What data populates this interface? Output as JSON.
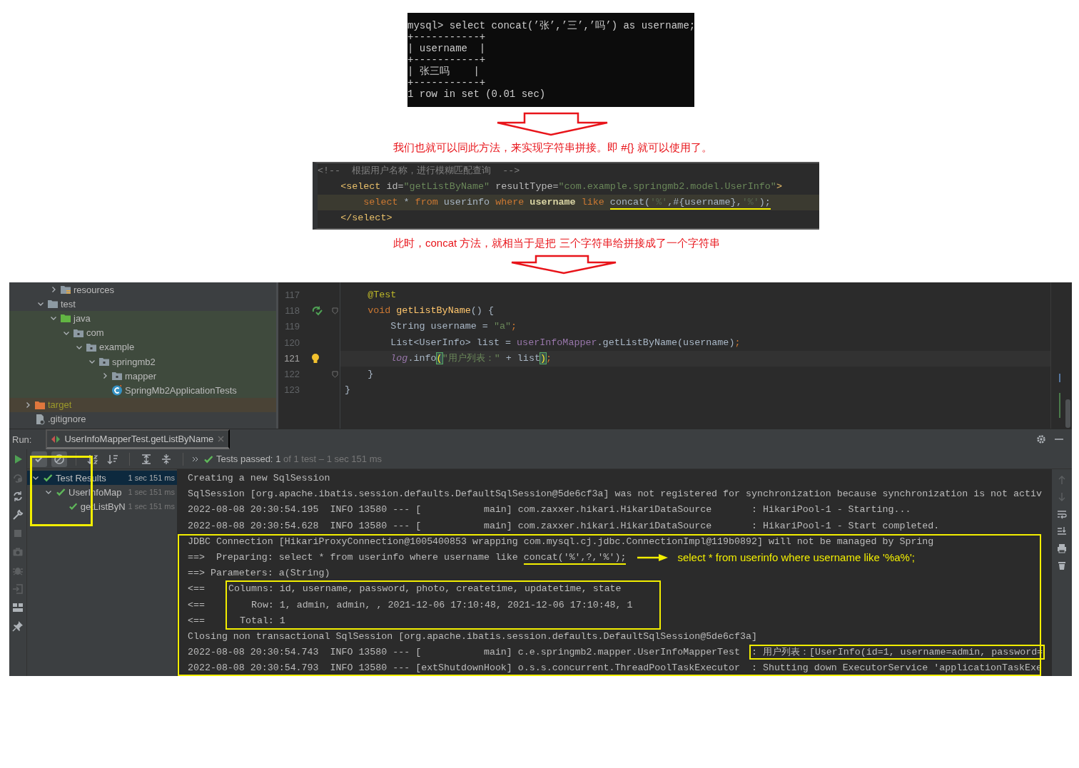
{
  "terminal": {
    "lines": [
      "mysql> select concat(’张’,’三’,’吗’) as username;",
      "+-----------+",
      "| username  |",
      "+-----------+",
      "| 张三吗    |",
      "+-----------+",
      "1 row in set (0.01 sec)"
    ]
  },
  "caption_top": "我们也就可以同此方法，来实现字符串拼接。即 #{} 就可以使用了。",
  "xml_snippet": {
    "lines": [
      {
        "highlighted": false,
        "tokens": [
          {
            "kind": "comment",
            "text": "<!--  根据用户名称，进行模糊匹配查询  -->"
          }
        ]
      },
      {
        "highlighted": false,
        "tokens": [
          {
            "kind": "tag",
            "text": "    <select"
          },
          {
            "kind": "attr",
            "text": " id="
          },
          {
            "kind": "string",
            "text": "\"getListByName\""
          },
          {
            "kind": "attr",
            "text": " resultType="
          },
          {
            "kind": "string",
            "text": "\"com.example.springmb2.model.UserInfo\""
          },
          {
            "kind": "tag",
            "text": ">"
          }
        ]
      },
      {
        "highlighted": true,
        "tokens": [
          {
            "kind": "keyword",
            "text": "        select"
          },
          {
            "kind": "plain",
            "text": " * "
          },
          {
            "kind": "keyword",
            "text": "from"
          },
          {
            "kind": "plain",
            "text": " userinfo "
          },
          {
            "kind": "keyword",
            "text": "where"
          },
          {
            "kind": "column",
            "text": " username "
          },
          {
            "kind": "keyword",
            "text": "like "
          }
        ],
        "underlined": [
          {
            "kind": "plain",
            "text": "concat("
          },
          {
            "kind": "faded",
            "text": "'%'"
          },
          {
            "kind": "plain",
            "text": ",#{username},"
          },
          {
            "kind": "faded",
            "text": "'%'"
          },
          {
            "kind": "plain",
            "text": ");"
          }
        ]
      },
      {
        "highlighted": false,
        "tokens": [
          {
            "kind": "tag",
            "text": "    </select>"
          }
        ]
      }
    ]
  },
  "caption_bottom": "此时，concat 方法，就相当于是把 三个字符串给拼接成了一个字符串",
  "ide": {
    "project_tree": [
      {
        "children": [
          {
            "children": [
              {
                "label": "resources",
                "kind": "resources",
                "expanded": false
              }
            ]
          },
          {
            "label": "test",
            "kind": "folder",
            "expanded": true,
            "children": [
              {
                "label": "java",
                "kind": "test-sources",
                "expanded": true,
                "children": [
                  {
                    "label": "com",
                    "kind": "package",
                    "expanded": true,
                    "children": [
                      {
                        "label": "example",
                        "kind": "package",
                        "expanded": true,
                        "children": [
                          {
                            "label": "springmb2",
                            "kind": "package",
                            "expanded": true,
                            "children": [
                              {
                                "label": "mapper",
                                "kind": "package",
                                "expanded": false
                              },
                              {
                                "label": "SpringMb2ApplicationTests",
                                "kind": "class"
                              }
                            ]
                          }
                        ]
                      }
                    ]
                  }
                ]
              }
            ]
          }
        ]
      },
      {
        "label": "target",
        "kind": "excluded",
        "expanded": false
      },
      {
        "label": ".gitignore",
        "kind": "file"
      }
    ],
    "editor": {
      "lines": [
        {
          "number": "117",
          "current": false,
          "fold": false,
          "runnable": false,
          "hint": false,
          "tokens": [
            {
              "kind": "annotation",
              "text": "    @Test"
            }
          ]
        },
        {
          "number": "118",
          "current": false,
          "fold": true,
          "runnable": true,
          "hint": false,
          "tokens": [
            {
              "kind": "keyword",
              "text": "    void "
            },
            {
              "kind": "method",
              "text": "getListByName"
            },
            {
              "kind": "plain",
              "text": "() {"
            }
          ]
        },
        {
          "number": "119",
          "current": false,
          "fold": false,
          "runnable": false,
          "hint": false,
          "tokens": [
            {
              "kind": "plain",
              "text": "        String username = "
            },
            {
              "kind": "string",
              "text": "\"a\""
            },
            {
              "kind": "keyword",
              "text": ";"
            }
          ]
        },
        {
          "number": "120",
          "current": false,
          "fold": false,
          "runnable": false,
          "hint": false,
          "tokens": [
            {
              "kind": "plain",
              "text": "        List<UserInfo> list = "
            },
            {
              "kind": "field",
              "text": "userInfoMapper"
            },
            {
              "kind": "plain",
              "text": ".getListByName(username)"
            },
            {
              "kind": "keyword",
              "text": ";"
            }
          ]
        },
        {
          "number": "121",
          "current": true,
          "fold": false,
          "runnable": false,
          "hint": true,
          "tokens": [
            {
              "kind": "static_field",
              "text": "        log"
            },
            {
              "kind": "plain",
              "text": ".info"
            },
            {
              "kind": "brace",
              "text": "("
            },
            {
              "kind": "string",
              "text": "\"用户列表：\""
            },
            {
              "kind": "plain",
              "text": " + list"
            },
            {
              "kind": "brace",
              "text": ")"
            },
            {
              "kind": "keyword",
              "text": ";"
            }
          ]
        },
        {
          "number": "122",
          "current": false,
          "fold": true,
          "runnable": false,
          "hint": false,
          "tokens": [
            {
              "kind": "plain",
              "text": "    }"
            }
          ]
        },
        {
          "number": "123",
          "current": false,
          "fold": false,
          "runnable": false,
          "hint": false,
          "tokens": [
            {
              "kind": "plain",
              "text": "}"
            }
          ]
        }
      ]
    },
    "run": {
      "label": "Run:",
      "tab": {
        "title": "UserInfoMapperTest.getListByName"
      },
      "side_tools": [
        {
          "kind": "run",
          "disabled": false
        },
        {
          "kind": "rerun-failed",
          "disabled": true
        },
        {
          "kind": "toggle-auto-test",
          "disabled": false
        },
        {
          "kind": "settings",
          "disabled": false
        },
        {
          "kind": "stop",
          "disabled": true
        },
        {
          "kind": "camera",
          "disabled": true
        },
        {
          "kind": "debug",
          "disabled": true
        },
        {
          "kind": "exit",
          "disabled": true
        },
        {
          "kind": "layout",
          "disabled": false
        },
        {
          "kind": "pin",
          "disabled": false
        }
      ],
      "toolbar": [
        {
          "kind": "show-passed",
          "pressed": true
        },
        {
          "kind": "show-ignored",
          "pressed": true
        },
        {
          "kind": "sort-alpha",
          "pressed": false
        },
        {
          "kind": "sort-duration",
          "pressed": false
        },
        {
          "kind": "expand-all",
          "pressed": false
        },
        {
          "kind": "collapse-all",
          "pressed": false
        }
      ],
      "status": {
        "label": "Tests passed:",
        "count": "1",
        "detail": "of 1 test – 1 sec 151 ms"
      },
      "test_tree": [
        {
          "label": "Test Results",
          "time": "1 sec 151 ms",
          "expanded": true,
          "selected": true,
          "children": [
            {
              "label": "UserInfoMap",
              "time": "1 sec 151 ms",
              "expanded": true,
              "selected": false,
              "children": [
                {
                  "label": "getListByN",
                  "time": "1 sec 151 ms",
                  "selected": false
                }
              ]
            }
          ]
        }
      ],
      "console": {
        "lines": [
          "Creating a new SqlSession",
          "SqlSession [org.apache.ibatis.session.defaults.DefaultSqlSession@5de6cf3a] was not registered for synchronization because synchronization is not activ",
          "2022-08-08 20:30:54.195  INFO 13580 --- [           main] com.zaxxer.hikari.HikariDataSource       : HikariPool-1 - Starting...",
          "2022-08-08 20:30:54.628  INFO 13580 --- [           main] com.zaxxer.hikari.HikariDataSource       : HikariPool-1 - Start completed."
        ],
        "boxed_lines": [
          {
            "kind": "plain",
            "text": "JDBC Connection [HikariProxyConnection@1005400853 wrapping com.mysql.cj.jdbc.ConnectionImpl@119b0892] will not be managed by Spring"
          },
          {
            "kind": "annotated",
            "text": "==>  Preparing: select * from userinfo where username like ",
            "underlined": "concat('%',?,'%');",
            "note": "select * from userinfo where username like '%a%';"
          },
          {
            "kind": "plain",
            "text": "==> Parameters: a(String)"
          },
          {
            "kind": "result_box",
            "prefixes": [
              "<==",
              "<==",
              "<=="
            ],
            "rows": [
              "Columns: id, username, password, photo, createtime, updatetime, state",
              "    Row: 1, admin, admin, , 2021-12-06 17:10:48, 2021-12-06 17:10:48, 1",
              "  Total: 1"
            ]
          },
          {
            "kind": "plain",
            "text": "Closing non transactional SqlSession [org.apache.ibatis.session.defaults.DefaultSqlSession@5de6cf3a]"
          },
          {
            "kind": "boxed_tail",
            "text": "2022-08-08 20:30:54.743  INFO 13580 --- [           main] c.e.springmb2.mapper.UserInfoMapperTest  ",
            "boxed": ": 用户列表：[UserInfo(id=1, username=admin, password="
          },
          {
            "kind": "plain",
            "text": "2022-08-08 20:30:54.793  INFO 13580 --- [extShutdownHook] o.s.s.concurrent.ThreadPoolTaskExecutor  : Shutting down ExecutorService 'applicationTaskExe"
          }
        ]
      }
    }
  }
}
